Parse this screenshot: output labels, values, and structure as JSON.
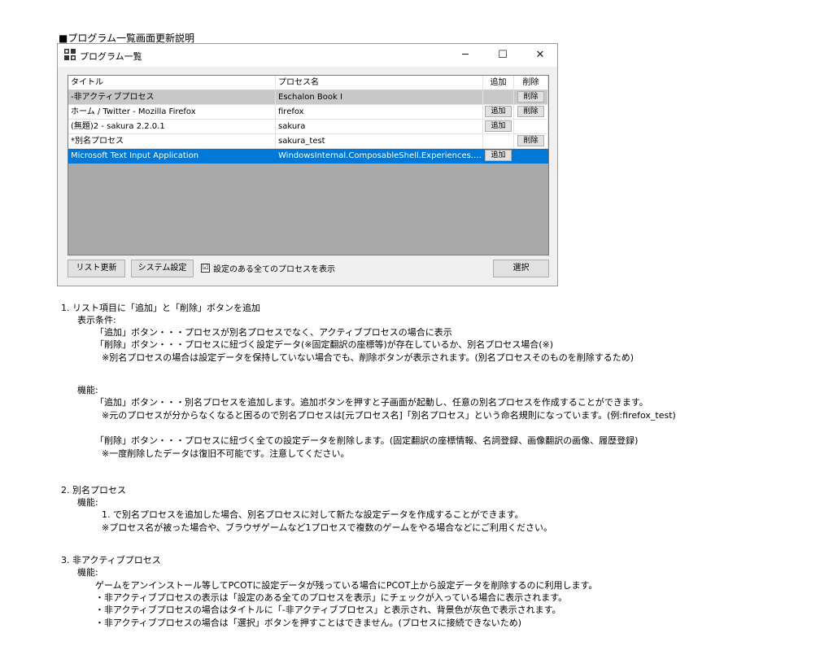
{
  "heading": "■プログラム一覧画面更新説明",
  "window": {
    "title": "プログラム一覧",
    "controls": {
      "minimize": "─",
      "maximize": "☐",
      "close": "✕"
    }
  },
  "list": {
    "columns": {
      "title": "タイトル",
      "process": "プロセス名",
      "add": "追加",
      "delete": "削除"
    },
    "rows": [
      {
        "title": "-非アクティブプロセス",
        "process": "Eschalon Book I",
        "add": "",
        "delete": "削除",
        "style": "gray"
      },
      {
        "title": "ホーム / Twitter - Mozilla Firefox",
        "process": "firefox",
        "add": "追加",
        "delete": "削除",
        "style": "white"
      },
      {
        "title": "(無題)2 - sakura 2.2.0.1",
        "process": "sakura",
        "add": "追加",
        "delete": "",
        "style": "white"
      },
      {
        "title": "*別名プロセス",
        "process": "sakura_test",
        "add": "",
        "delete": "削除",
        "style": "white"
      },
      {
        "title": "Microsoft Text Input Application",
        "process": "WindowsInternal.ComposableShell.Experiences.Te...",
        "add": "追加",
        "delete": "",
        "style": "selected"
      }
    ]
  },
  "buttons": {
    "refresh": "リスト更新",
    "system": "システム設定",
    "select": "選択",
    "show_all_label": "設定のある全てのプロセスを表示",
    "show_all_checked": "☑"
  },
  "doc": {
    "s1_title": "1. リスト項目に「追加」と「削除」ボタンを追加",
    "s1_cond_label": "表示条件:",
    "s1_cond_1": "「追加」ボタン・・・プロセスが別名プロセスでなく、アクティブプロセスの場合に表示",
    "s1_cond_2": "「削除」ボタン・・・プロセスに紐づく設定データ(※固定翻訳の座標等)が存在しているか、別名プロセス場合(※)",
    "s1_cond_3": "※別名プロセスの場合は設定データを保持していない場合でも、削除ボタンが表示されます。(別名プロセスそのものを削除するため)",
    "s1_func_label": "機能:",
    "s1_func_1": "「追加」ボタン・・・別名プロセスを追加します。追加ボタンを押すと子画面が起動し、任意の別名プロセスを作成することができます。",
    "s1_func_2": "※元のプロセスが分からなくなると困るので別名プロセスは[元プロセス名]「別名プロセス」という命名規則になっています。(例:firefox_test)",
    "s1_func_3": "「削除」ボタン・・・プロセスに紐づく全ての設定データを削除します。(固定翻訳の座標情報、名詞登録、画像翻訳の画像、履歴登録)",
    "s1_func_4": "※一度削除したデータは復旧不可能です。注意してください。",
    "s2_title": "2. 別名プロセス",
    "s2_func_label": "機能:",
    "s2_func_1": "1. で別名プロセスを追加した場合、別名プロセスに対して新たな設定データを作成することができます。",
    "s2_func_2": "※プロセス名が被った場合や、ブラウザゲームなど1プロセスで複数のゲームをやる場合などにご利用ください。",
    "s3_title": "3. 非アクティブプロセス",
    "s3_func_label": "機能:",
    "s3_func_1": "ゲームをアンインストール等してPCOTに設定データが残っている場合にPCOT上から設定データを削除するのに利用します。",
    "s3_func_2": "・非アクティブプロセスの表示は「設定のある全てのプロセスを表示」にチェックが入っている場合に表示されます。",
    "s3_func_3": "・非アクティブプロセスの場合はタイトルに「-非アクティブプロセス」と表示され、背景色が灰色で表示されます。",
    "s3_func_4": "・非アクティブプロセスの場合は「選択」ボタンを押すことはできません。(プロセスに接続できないため)"
  }
}
